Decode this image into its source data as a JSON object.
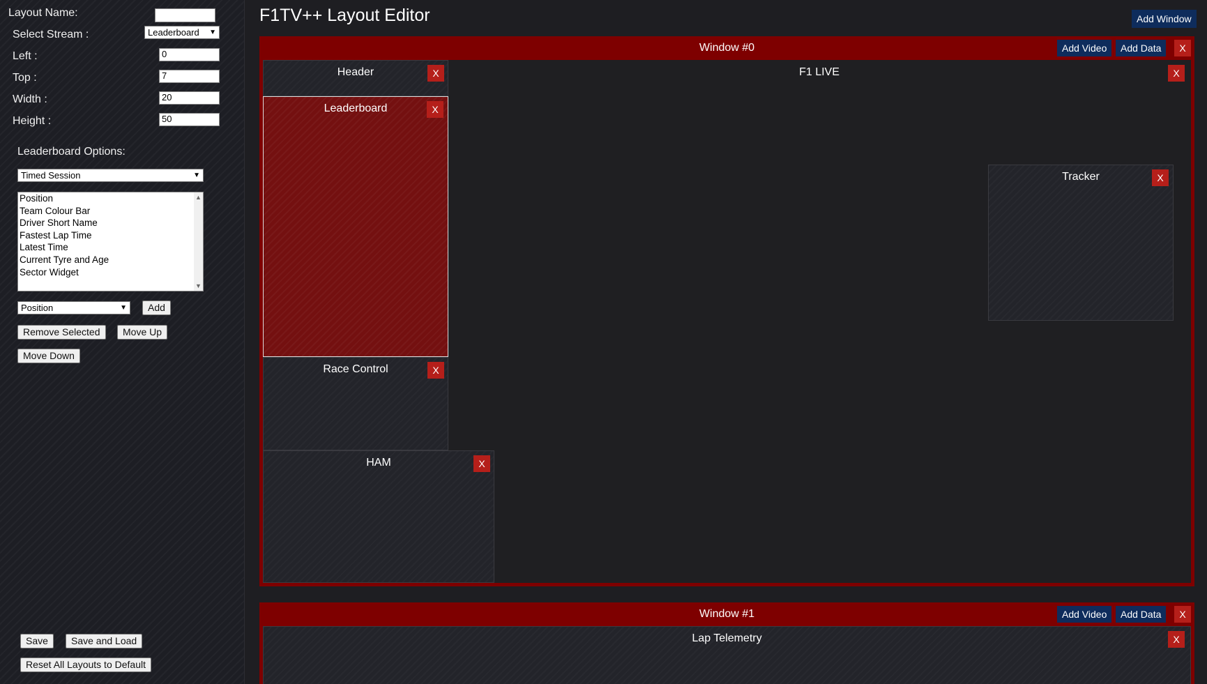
{
  "sidebar": {
    "layout_name_label": "Layout Name:",
    "layout_name_value": "",
    "select_stream_label": "Select Stream :",
    "select_stream_value": "Leaderboard",
    "left_label": "Left :",
    "left_value": "0",
    "top_label": "Top :",
    "top_value": "7",
    "width_label": "Width :",
    "width_value": "20",
    "height_label": "Height :",
    "height_value": "50",
    "options_label": "Leaderboard Options:",
    "session_select_value": "Timed Session",
    "fields": [
      "Position",
      "Team Colour Bar",
      "Driver Short Name",
      "Fastest Lap Time",
      "Latest Time",
      "Current Tyre and Age",
      "Sector Widget"
    ],
    "add_field_select_value": "Position",
    "add_button": "Add",
    "remove_selected_button": "Remove Selected",
    "move_up_button": "Move Up",
    "move_down_button": "Move Down",
    "save_button": "Save",
    "save_and_load_button": "Save and Load",
    "reset_button": "Reset All Layouts to Default"
  },
  "header": {
    "title": "F1TV++ Layout Editor",
    "add_window_button": "Add Window"
  },
  "windows": [
    {
      "title": "Window #0",
      "add_video": "Add Video",
      "add_data": "Add Data",
      "close": "X",
      "panels": {
        "header": "Header",
        "f1live": "F1 LIVE",
        "leaderboard": "Leaderboard",
        "tracker": "Tracker",
        "race_control": "Race Control",
        "ham": "HAM"
      }
    },
    {
      "title": "Window #1",
      "add_video": "Add Video",
      "add_data": "Add Data",
      "close": "X",
      "panels": {
        "lap_telemetry": "Lap Telemetry"
      }
    }
  ],
  "close_label": "X",
  "colors": {
    "window_header": "#7e0000",
    "close_button": "#b51f1a",
    "action_button": "#0e2c5c",
    "selected_panel": "#741010"
  }
}
